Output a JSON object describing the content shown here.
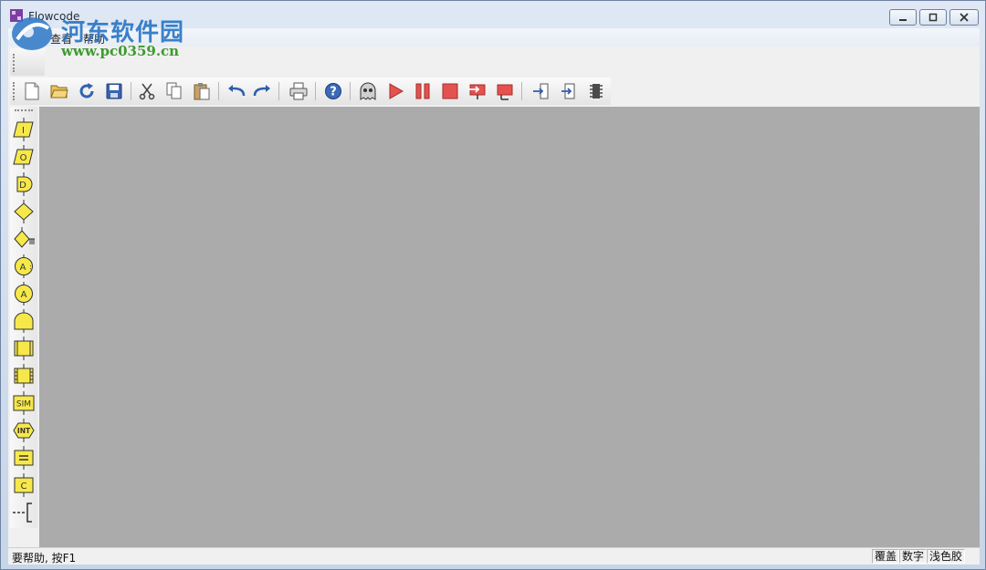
{
  "window": {
    "title": "Flowcode"
  },
  "menu": {
    "items": [
      "查看",
      "帮助"
    ]
  },
  "watermark": {
    "name": "河东软件园",
    "url": "www.pc0359.cn"
  },
  "status": {
    "help_text": "要帮助, 按F1",
    "panes": [
      "覆盖",
      "数字",
      "浅色胶"
    ]
  },
  "palette": {
    "labels": {
      "input": "I",
      "output": "O",
      "delay": "D",
      "sim": "SIM",
      "interrupt": "INT",
      "code": "C",
      "macro": "A"
    }
  },
  "colors": {
    "workspace": "#ababab",
    "palette_yellow": "#f7e84a",
    "accent_red": "#e4524f"
  }
}
